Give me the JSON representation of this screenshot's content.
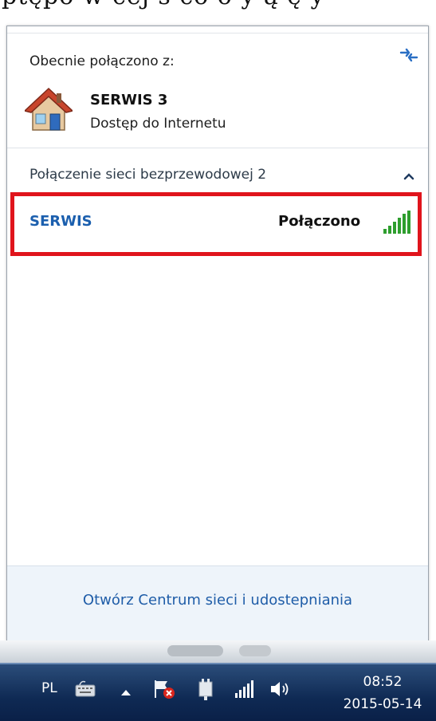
{
  "page": {
    "top_text": "ptępo w cej s co     o   y        ą ę y"
  },
  "popup": {
    "current_label": "Obecnie połączono z:",
    "network_name": "SERWIS  3",
    "network_status": "Dostęp do Internetu",
    "section_label": "Połączenie sieci bezprzewodowej 2",
    "wifi_row": {
      "name": "SERWIS",
      "status": "Połączono"
    },
    "footer_link": "Otwórz Centrum sieci i udostepniania"
  },
  "taskbar": {
    "language": "PL",
    "time": "08:52",
    "date": "2015-05-14",
    "icons": [
      "keyboard-icon",
      "show-hidden-icons-icon",
      "action-center-flag-icon",
      "power-plug-icon",
      "wifi-signal-icon",
      "speaker-icon"
    ]
  },
  "colors": {
    "highlight_border": "#e0141c",
    "link": "#1f5da8",
    "taskbar": "#0f2a54",
    "signal_green": "#2e9e2e"
  }
}
